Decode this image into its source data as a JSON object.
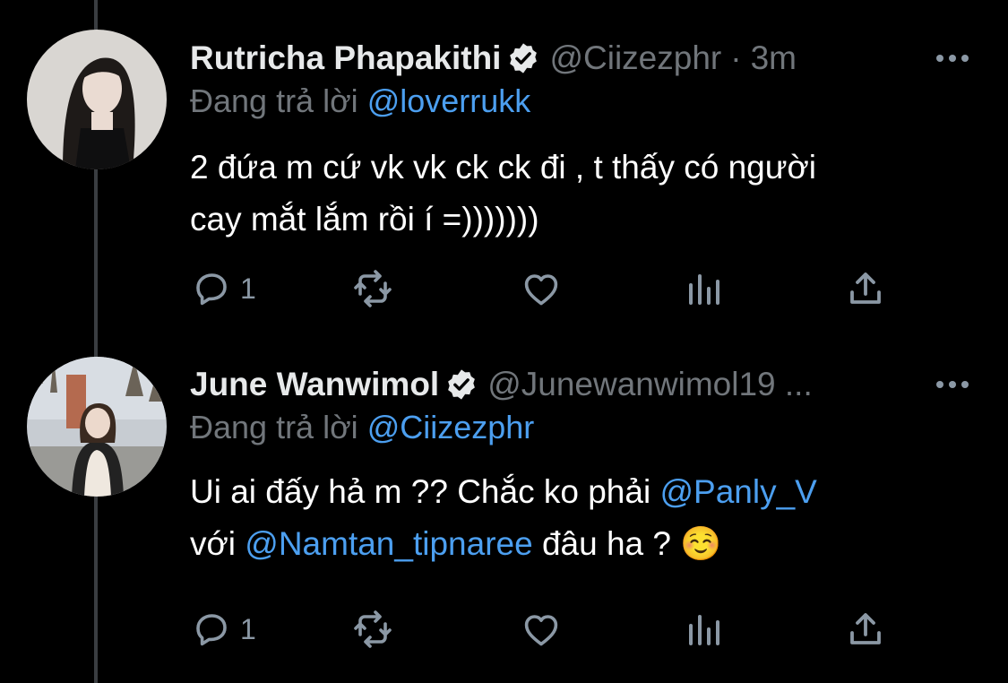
{
  "tweets": [
    {
      "display_name": "Rutricha Phapakithi",
      "handle": "@Ciizezphr",
      "separator": "·",
      "time": "3m",
      "replying_prefix": "Đang trả lời",
      "replying_to": "@loverrukk",
      "text_line1": "2 đứa m cứ vk vk ck ck đi , t thấy có người",
      "text_line2": "cay mắt lắm rồi í =)))))))",
      "reply_count": "1"
    },
    {
      "display_name": "June Wanwimol",
      "handle": "@Junewanwimol19 ...",
      "replying_prefix": "Đang trả lời",
      "replying_to": "@Ciizezphr",
      "text_part1": "Ui ai đấy hả m ?? Chắc ko phải ",
      "mention1": "@Panly_V",
      "text_part2": "với ",
      "mention2": "@Namtan_tipnaree",
      "text_part3": " đâu ha ? ☺️",
      "reply_count": "1"
    }
  ],
  "icons": {
    "verified": "verified-badge-icon",
    "more": "more-icon",
    "reply": "reply-icon",
    "retweet": "retweet-icon",
    "like": "like-icon",
    "views": "views-icon",
    "share": "share-icon"
  },
  "colors": {
    "background": "#000000",
    "text": "#e7e9ea",
    "secondary": "#71767b",
    "link": "#4c9ff0",
    "thread_line": "#3a3d41"
  }
}
